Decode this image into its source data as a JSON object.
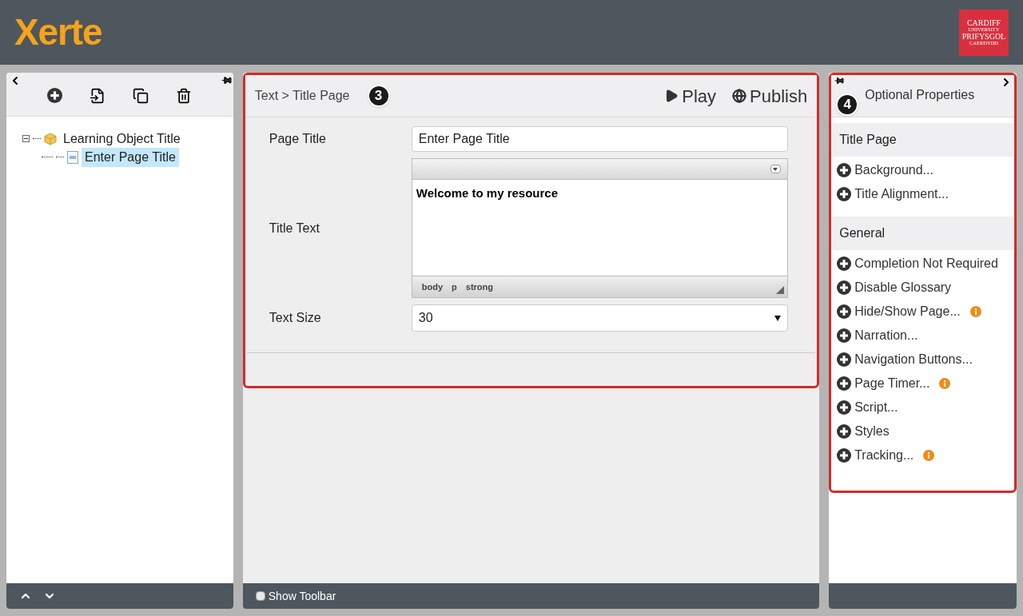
{
  "header": {
    "logo": "Xerte",
    "university_logo": [
      "CARDIFF",
      "UNIVERSITY",
      "PRIFYSGOL",
      "CAERDYDD"
    ]
  },
  "tree": [
    {
      "label": "Learning Object Title",
      "kind": "folder",
      "expanded": true,
      "selected": false,
      "children": [
        {
          "label": "Enter Page Title",
          "kind": "page",
          "selected": true
        }
      ]
    }
  ],
  "editor": {
    "breadcrumb": "Text > Title Page",
    "callout": "3",
    "play": "Play",
    "publish": "Publish",
    "fields": [
      {
        "kind": "text",
        "label": "Page Title",
        "value": "Enter Page Title"
      },
      {
        "kind": "richtext",
        "label": "Title Text",
        "value": "Welcome to my resource",
        "path": [
          "body",
          "p",
          "strong"
        ]
      },
      {
        "kind": "select",
        "label": "Text Size",
        "value": "30"
      }
    ]
  },
  "toolbar_toggle": {
    "label": "Show Toolbar",
    "checked": false
  },
  "optional_properties": {
    "title": "Optional Properties",
    "callout": "4",
    "sections": [
      {
        "title": "Title Page",
        "items": [
          {
            "label": "Background...",
            "info": false
          },
          {
            "label": "Title Alignment...",
            "info": false
          }
        ]
      },
      {
        "title": "General",
        "items": [
          {
            "label": "Completion Not Required",
            "info": false
          },
          {
            "label": "Disable Glossary",
            "info": false
          },
          {
            "label": "Hide/Show Page...",
            "info": true
          },
          {
            "label": "Narration...",
            "info": false
          },
          {
            "label": "Navigation Buttons...",
            "info": false
          },
          {
            "label": "Page Timer...",
            "info": true
          },
          {
            "label": "Script...",
            "info": false
          },
          {
            "label": "Styles",
            "info": false
          },
          {
            "label": "Tracking...",
            "info": true
          }
        ]
      }
    ]
  }
}
